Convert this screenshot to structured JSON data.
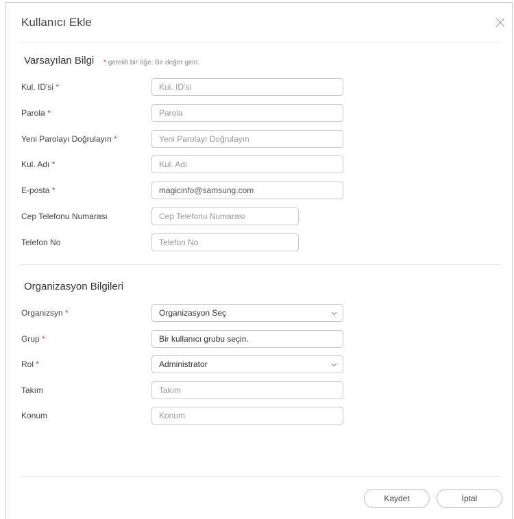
{
  "dialog": {
    "title": "Kullanıcı Ekle",
    "close_icon": "close-icon"
  },
  "basic": {
    "section_title": "Varsayılan Bilgi",
    "required_star": "*",
    "required_note": "gerekli bir öğe. Bir değer girin.",
    "fields": {
      "user_id": {
        "label": "Kul. ID'si",
        "placeholder": "Kul. ID'si"
      },
      "password": {
        "label": "Parola",
        "placeholder": "Parola"
      },
      "confirm_password": {
        "label": "Yeni Parolayı Doğrulayın",
        "placeholder": "Yeni Parolayı Doğrulayın"
      },
      "user_name": {
        "label": "Kul. Adı",
        "placeholder": "Kul. Adı"
      },
      "email": {
        "label": "E-posta",
        "value": "magicinfo@samsung.com"
      },
      "mobile": {
        "label": "Cep Telefonu Numarası",
        "placeholder": "Cep Telefonu Numarası"
      },
      "phone": {
        "label": "Telefon No",
        "placeholder": "Telefon No"
      }
    }
  },
  "org": {
    "section_title": "Organizasyon Bilgileri",
    "fields": {
      "organization": {
        "label": "Organizsyn",
        "selected": "Organizasyon Seç"
      },
      "group": {
        "label": "Grup",
        "value": "Bir kullanıcı grubu seçin."
      },
      "role": {
        "label": "Rol",
        "selected": "Administrator"
      },
      "team": {
        "label": "Takım",
        "placeholder": "Takım"
      },
      "location": {
        "label": "Konum",
        "placeholder": "Konum"
      }
    }
  },
  "footer": {
    "save_label": "Kaydet",
    "cancel_label": "İptal"
  },
  "colors": {
    "required": "#e2343f",
    "border": "#c9c9c9"
  }
}
